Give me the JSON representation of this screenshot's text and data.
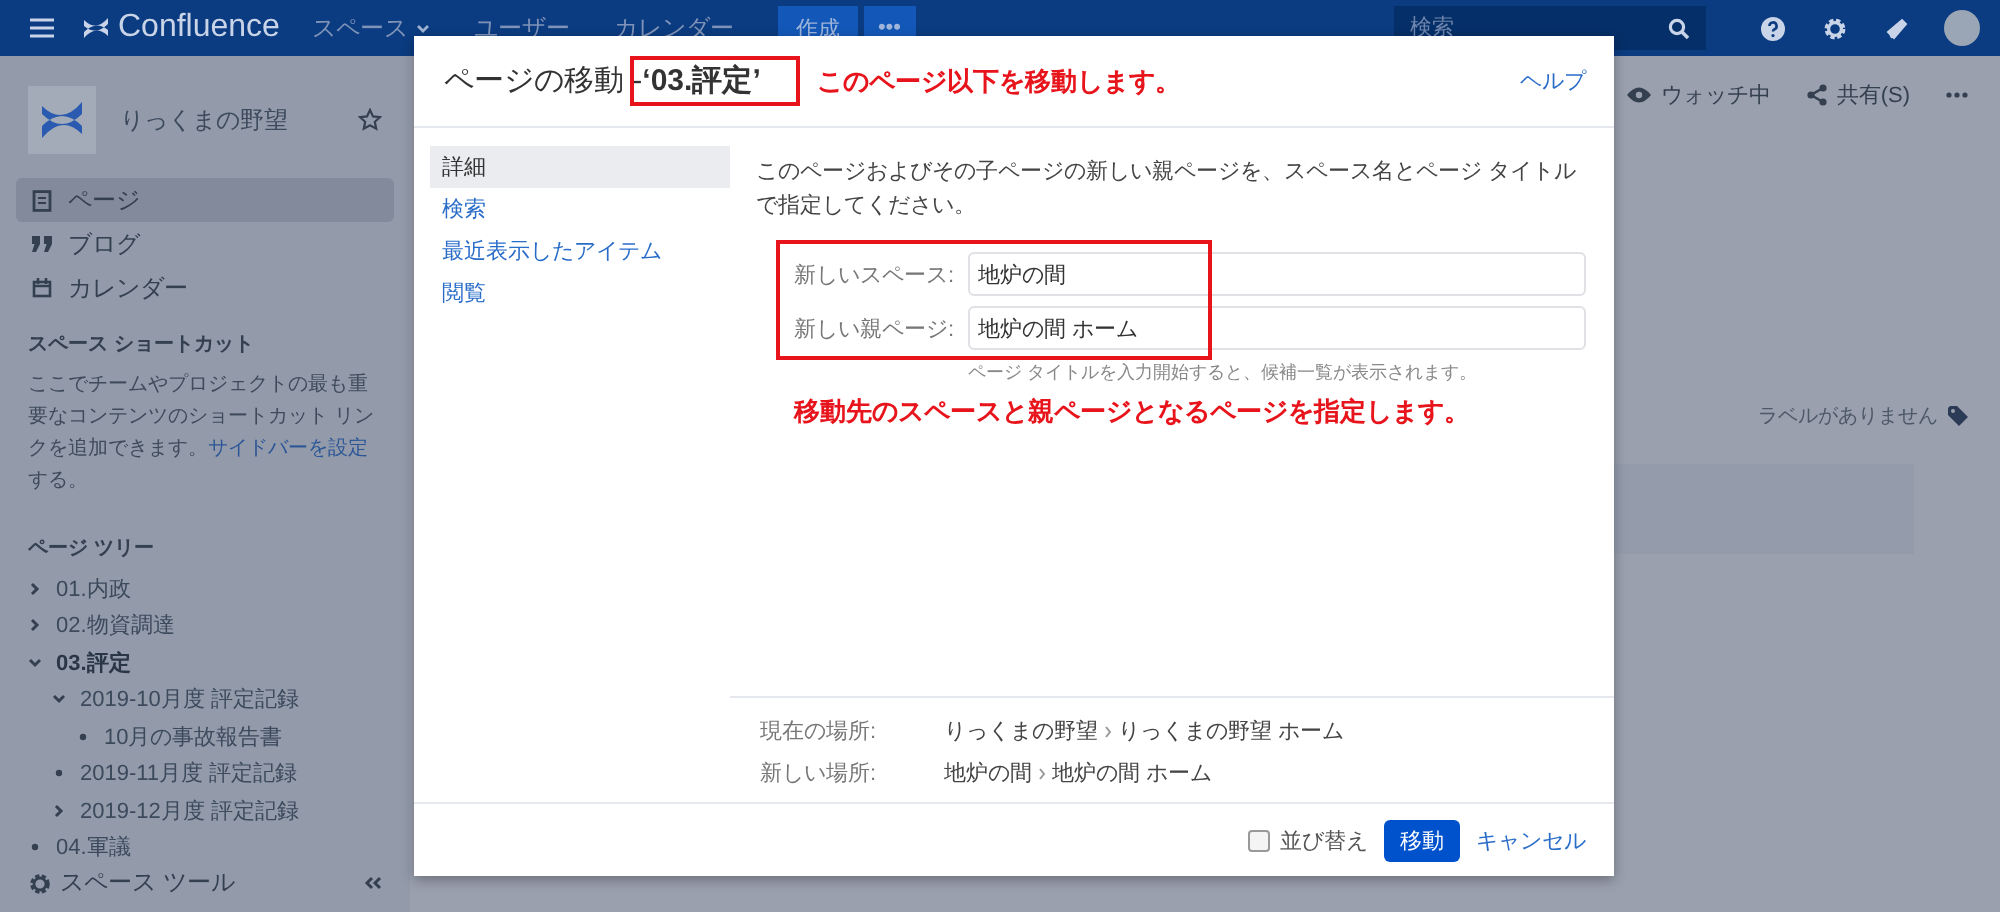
{
  "topbar": {
    "logo_text": "Confluence",
    "nav": [
      {
        "label": "スペース",
        "dropdown": true
      },
      {
        "label": "ユーザー",
        "dropdown": false
      },
      {
        "label": "カレンダー",
        "dropdown": false
      }
    ],
    "create_button": "作成",
    "more_button": "•••",
    "search": {
      "placeholder": "検索"
    }
  },
  "sidebar": {
    "space_name": "りっくまの野望",
    "nav": [
      {
        "label": "ページ",
        "selected": true
      },
      {
        "label": "ブログ",
        "selected": false
      },
      {
        "label": "カレンダー",
        "selected": false
      }
    ],
    "shortcuts_heading": "スペース ショートカット",
    "shortcuts_text": "ここでチームやプロジェクトの最も重要なコンテンツのショートカット リンクを追加できます。",
    "shortcuts_link": "サイドバーを設定",
    "shortcuts_tail": "する。",
    "tree_heading": "ページ ツリー",
    "tree": [
      {
        "label": "01.内政",
        "kind": "branch",
        "expanded": false,
        "selected": false
      },
      {
        "label": "02.物資調達",
        "kind": "branch",
        "expanded": false,
        "selected": false
      },
      {
        "label": "03.評定",
        "kind": "branch",
        "expanded": true,
        "selected": true,
        "children": [
          {
            "label": "2019-10月度 評定記録",
            "kind": "branch",
            "expanded": true,
            "selected": false,
            "children": [
              {
                "label": "10月の事故報告書",
                "kind": "leaf",
                "selected": false
              }
            ]
          },
          {
            "label": "2019-11月度 評定記録",
            "kind": "leaf",
            "selected": false
          },
          {
            "label": "2019-12月度 評定記録",
            "kind": "branch",
            "expanded": false,
            "selected": false
          }
        ]
      },
      {
        "label": "04.軍議",
        "kind": "leaf",
        "selected": false
      }
    ],
    "tools_label": "スペース ツール"
  },
  "page_actions": {
    "watch": "ウォッチ中",
    "share": "共有(S)",
    "labels_text": "ラベルがありません"
  },
  "dialog": {
    "title": "ページの移動 - ",
    "page_name": "‘03.評定’",
    "help_link": "ヘルプ",
    "menu": [
      {
        "label": "詳細",
        "selected": true
      },
      {
        "label": "検索",
        "selected": false
      },
      {
        "label": "最近表示したアイテム",
        "selected": false
      },
      {
        "label": "閲覧",
        "selected": false
      }
    ],
    "description": "このページおよびその子ページの新しい親ページを、スペース名とページ タイトルで指定してください。",
    "fields": [
      {
        "label": "新しいスペース:",
        "value": "地炉の間"
      },
      {
        "label": "新しい親ページ:",
        "value": "地炉の間 ホーム"
      }
    ],
    "hint": "ページ タイトルを入力開始すると、候補一覧が表示されます。",
    "locations": [
      {
        "label": "現在の場所:",
        "path": [
          "りっくまの野望",
          "りっくまの野望 ホーム"
        ]
      },
      {
        "label": "新しい場所:",
        "path": [
          "地炉の間",
          "地炉の間 ホーム"
        ]
      }
    ],
    "reorder": {
      "label": "並び替え",
      "checked": false
    },
    "move_button": "移動",
    "cancel_link": "キャンセル"
  },
  "annotations": {
    "title_note": "このページ以下を移動します。",
    "form_note": "移動先のスペースと親ページとなるページを指定します。"
  }
}
